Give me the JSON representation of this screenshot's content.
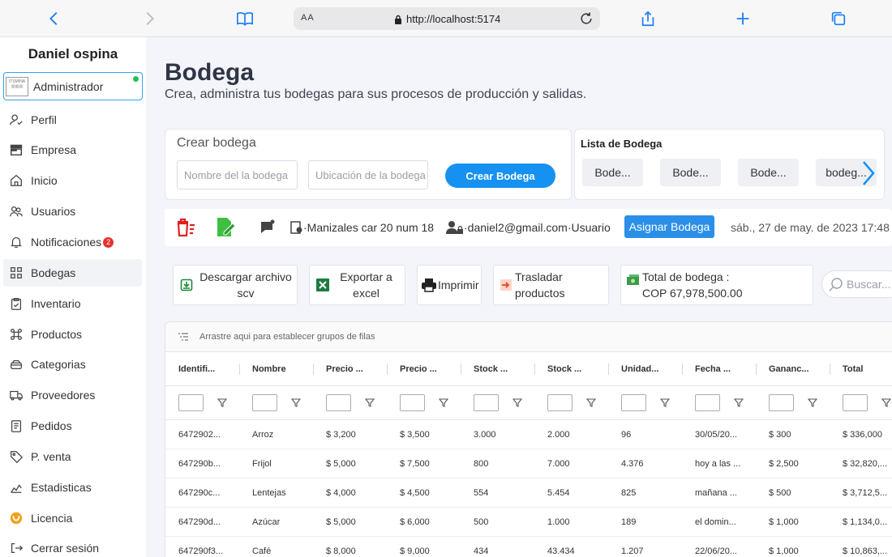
{
  "browser": {
    "aa_label": "AA",
    "url": "http://localhost:5174"
  },
  "sidebar": {
    "user_name": "Daniel ospina",
    "role": "Administrador",
    "items": [
      {
        "label": "Perfil",
        "icon": "user-check-icon"
      },
      {
        "label": "Empresa",
        "icon": "store-icon"
      },
      {
        "label": "Inicio",
        "icon": "home-icon"
      },
      {
        "label": "Usuarios",
        "icon": "users-icon"
      },
      {
        "label": "Notificaciones",
        "icon": "bell-icon",
        "badge": "2"
      },
      {
        "label": "Bodegas",
        "icon": "grid-icon"
      },
      {
        "label": "Inventario",
        "icon": "clipboard-check-icon"
      },
      {
        "label": "Productos",
        "icon": "command-icon"
      },
      {
        "label": "Categorias",
        "icon": "layers-icon"
      },
      {
        "label": "Proveedores",
        "icon": "truck-icon"
      },
      {
        "label": "Pedidos",
        "icon": "document-icon"
      },
      {
        "label": "P. venta",
        "icon": "tag-icon"
      },
      {
        "label": "Estadisticas",
        "icon": "chart-icon"
      },
      {
        "label": "Licencia",
        "icon": "license-icon"
      },
      {
        "label": "Cerrar sesión",
        "icon": "logout-icon"
      }
    ]
  },
  "page": {
    "title": "Bodega",
    "subtitle": "Crea, administra tus bodegas para sus procesos de producción y salidas."
  },
  "create": {
    "heading": "Crear bodega",
    "name_placeholder": "Nombre del la bodega",
    "location_placeholder": "Ubicación de la bodega",
    "button": "Crear Bodega"
  },
  "list": {
    "heading": "Lista de Bodega",
    "chips": [
      "Bode...",
      "Bode...",
      "Bode...",
      "bodeg..."
    ]
  },
  "info": {
    "location": "·Manizales car 20 num 18",
    "email": "·daniel2@gmail.com",
    "role": "·Usuario",
    "assign_button": "Asignar Bodega",
    "date": "sáb., 27 de may. de 2023 17:48 ·"
  },
  "actions": {
    "download": "Descargar archivo scv",
    "export": "Exportar a excel",
    "print": "Imprimir",
    "transfer": "Trasladar productos",
    "total_label": "Total de bodega :",
    "total_value": "COP 67,978,500.00",
    "search_placeholder": "Buscar..."
  },
  "grid": {
    "group_hint": "Arrastre aqui para establecer grupos de filas",
    "headers": [
      "Identifi...",
      "Nombre",
      "Precio ...",
      "Precio ...",
      "Stock ...",
      "Stock ...",
      "Unidad...",
      "Fecha ...",
      "Gananc...",
      "Total"
    ],
    "rows": [
      [
        "6472902...",
        "Arroz",
        "$ 3,200",
        "$ 3,500",
        "3.000",
        "2.000",
        "96",
        "30/05/20...",
        "$ 300",
        "$ 336,000"
      ],
      [
        "647290b...",
        "Frijol",
        "$ 5,000",
        "$ 7,500",
        "800",
        "7.000",
        "4.376",
        "hoy a las ...",
        "$ 2,500",
        "$ 32,820,..."
      ],
      [
        "647290c...",
        "Lentejas",
        "$ 4,000",
        "$ 4,500",
        "554",
        "5.454",
        "825",
        "mañana ...",
        "$ 500",
        "$ 3,712,5..."
      ],
      [
        "647290d...",
        "Azúcar",
        "$ 5,000",
        "$ 6,000",
        "500",
        "1.000",
        "189",
        "el domin...",
        "$ 1,000",
        "$ 1,134,0..."
      ],
      [
        "647290f3...",
        "Café",
        "$ 8,000",
        "$ 9,000",
        "434",
        "43.434",
        "1.207",
        "22/06/20...",
        "$ 1,000",
        "$ 10,863,..."
      ]
    ]
  },
  "colors": {
    "accent": "#1591f2",
    "active_dot": "#24c05a",
    "badge": "#e5322d",
    "delete_icon": "#e32020",
    "edit_icon": "#3fbf3f"
  }
}
